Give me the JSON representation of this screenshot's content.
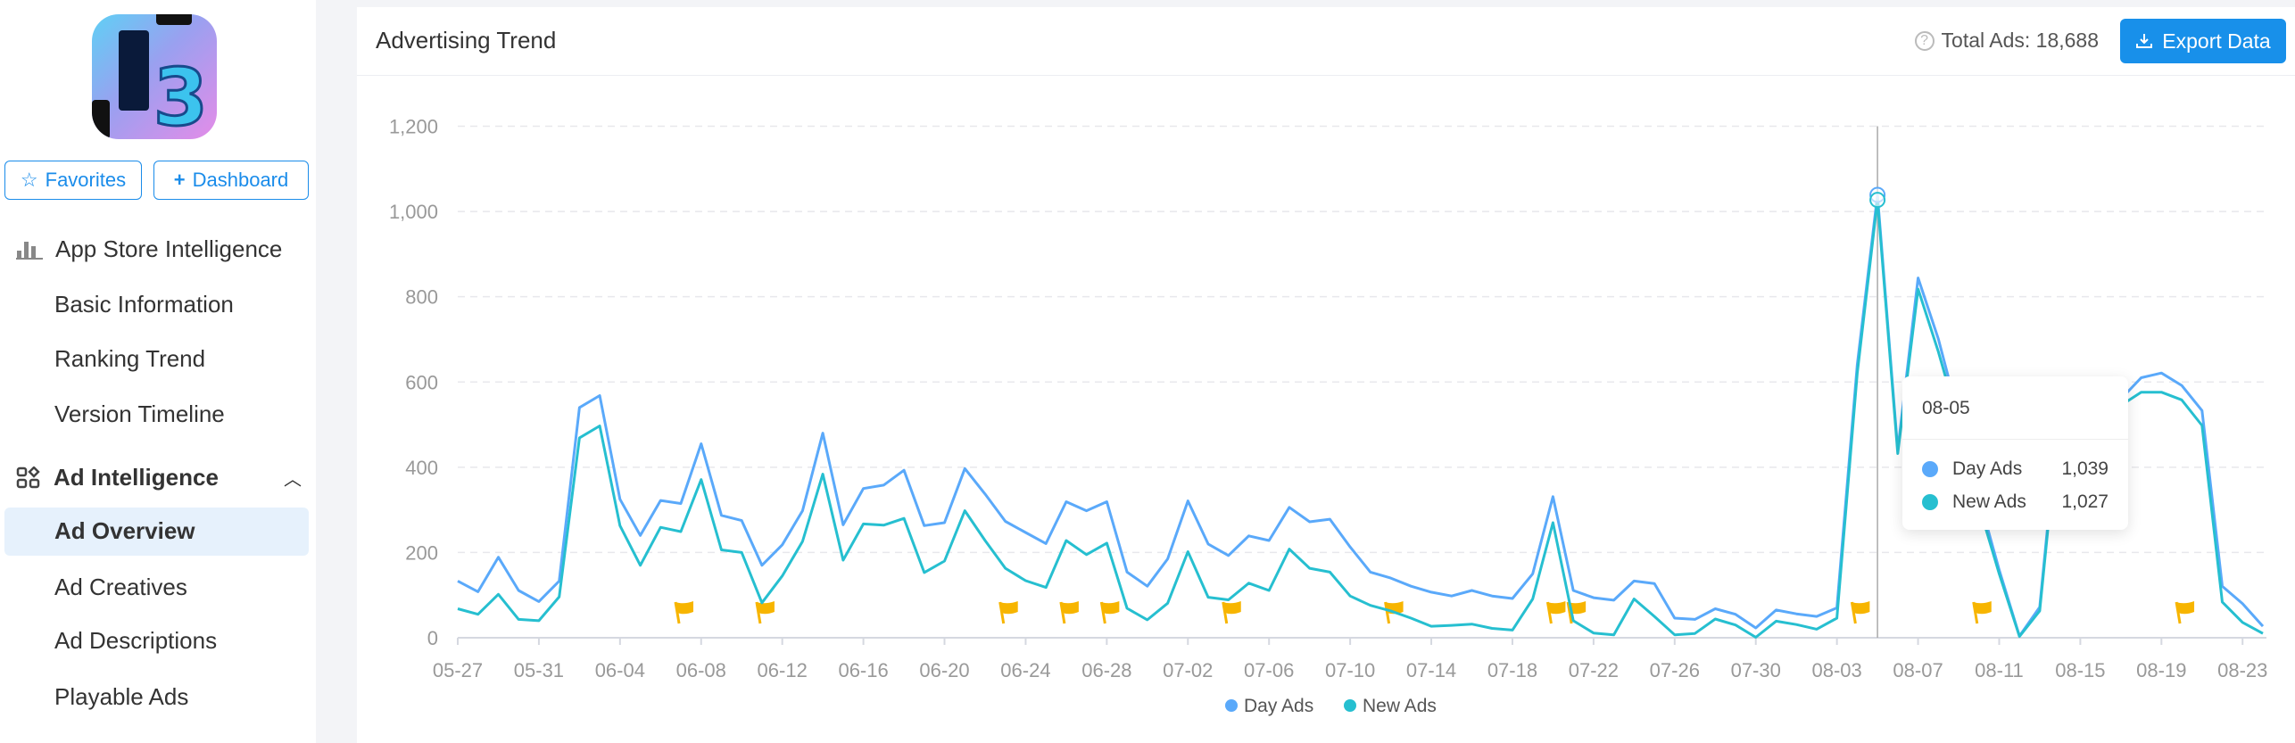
{
  "sidebar": {
    "app_icon_text": "3",
    "favorites_label": "Favorites",
    "dashboard_label": "Dashboard",
    "sections": [
      {
        "title": "App Store Intelligence",
        "icon": "bar-chart-icon",
        "items": [
          "Basic Information",
          "Ranking Trend",
          "Version Timeline"
        ]
      },
      {
        "title": "Ad Intelligence",
        "icon": "apps-grid-icon",
        "expanded": true,
        "items": [
          "Ad Overview",
          "Ad Creatives",
          "Ad Descriptions",
          "Playable Ads"
        ],
        "active": "Ad Overview"
      }
    ]
  },
  "card": {
    "title": "Advertising Trend",
    "total_label": "Total Ads: 18,688",
    "export_label": "Export Data"
  },
  "tooltip": {
    "date": "08-05",
    "rows": [
      {
        "name": "Day Ads",
        "value": "1,039"
      },
      {
        "name": "New Ads",
        "value": "1,027"
      }
    ]
  },
  "colors": {
    "day_ads": "#5aa9fa",
    "new_ads": "#26bfd0",
    "flag": "#f7b500",
    "accent": "#1890ea"
  },
  "chart_data": {
    "type": "line",
    "title": "",
    "xlabel": "",
    "ylabel": "",
    "ylim": [
      0,
      1200
    ],
    "y_ticks": [
      "0",
      "200",
      "400",
      "600",
      "800",
      "1,000",
      "1,200"
    ],
    "x_tick_labels": [
      "05-27",
      "05-31",
      "06-04",
      "06-08",
      "06-12",
      "06-16",
      "06-20",
      "06-24",
      "06-28",
      "07-02",
      "07-06",
      "07-10",
      "07-14",
      "07-18",
      "07-22",
      "07-26",
      "07-30",
      "08-03",
      "08-07",
      "08-11",
      "08-15",
      "08-19",
      "08-23"
    ],
    "grid": true,
    "legend": "bottom-center",
    "x": [
      "05-27",
      "05-28",
      "05-29",
      "05-30",
      "05-31",
      "06-01",
      "06-02",
      "06-03",
      "06-04",
      "06-05",
      "06-06",
      "06-07",
      "06-08",
      "06-09",
      "06-10",
      "06-11",
      "06-12",
      "06-13",
      "06-14",
      "06-15",
      "06-16",
      "06-17",
      "06-18",
      "06-19",
      "06-20",
      "06-21",
      "06-22",
      "06-23",
      "06-24",
      "06-25",
      "06-26",
      "06-27",
      "06-28",
      "06-29",
      "06-30",
      "07-01",
      "07-02",
      "07-03",
      "07-04",
      "07-05",
      "07-06",
      "07-07",
      "07-08",
      "07-09",
      "07-10",
      "07-11",
      "07-12",
      "07-13",
      "07-14",
      "07-15",
      "07-16",
      "07-17",
      "07-18",
      "07-19",
      "07-20",
      "07-21",
      "07-22",
      "07-23",
      "07-24",
      "07-25",
      "07-26",
      "07-27",
      "07-28",
      "07-29",
      "07-30",
      "07-31",
      "08-01",
      "08-02",
      "08-03",
      "08-04",
      "08-05",
      "08-06",
      "08-07",
      "08-08",
      "08-09",
      "08-10",
      "08-11",
      "08-12",
      "08-13",
      "08-14",
      "08-15",
      "08-16",
      "08-17",
      "08-18",
      "08-19",
      "08-20",
      "08-21",
      "08-22",
      "08-23",
      "08-24"
    ],
    "series": [
      {
        "name": "Day Ads",
        "values": [
          133,
          108,
          189,
          111,
          85,
          133,
          540,
          568,
          325,
          240,
          322,
          315,
          455,
          287,
          275,
          170,
          218,
          298,
          480,
          265,
          350,
          358,
          393,
          263,
          270,
          397,
          337,
          273,
          247,
          221,
          319,
          298,
          319,
          154,
          121,
          185,
          321,
          220,
          193,
          239,
          228,
          306,
          272,
          278,
          213,
          154,
          140,
          121,
          107,
          98,
          111,
          98,
          92,
          150,
          331,
          111,
          94,
          88,
          133,
          127,
          46,
          43,
          68,
          55,
          23,
          65,
          56,
          50,
          70,
          640,
          1039,
          440,
          844,
          701,
          520,
          330,
          159,
          4,
          72,
          560,
          580,
          570,
          560,
          610,
          621,
          592,
          533,
          121,
          80,
          27
        ]
      },
      {
        "name": "New Ads",
        "values": [
          68,
          55,
          102,
          43,
          40,
          96,
          469,
          497,
          263,
          170,
          259,
          249,
          371,
          206,
          200,
          82,
          145,
          226,
          384,
          182,
          267,
          264,
          280,
          153,
          180,
          298,
          228,
          163,
          134,
          118,
          228,
          195,
          222,
          69,
          42,
          81,
          202,
          95,
          89,
          128,
          111,
          208,
          163,
          154,
          98,
          76,
          63,
          46,
          27,
          29,
          32,
          22,
          18,
          91,
          270,
          40,
          11,
          7,
          91,
          50,
          7,
          10,
          44,
          30,
          1,
          39,
          31,
          20,
          46,
          620,
          1027,
          432,
          818,
          671,
          505,
          310,
          150,
          3,
          63,
          540,
          560,
          550,
          545,
          576,
          576,
          558,
          498,
          84,
          36,
          10
        ]
      }
    ],
    "event_flags": [
      "06-07",
      "06-11",
      "06-23",
      "06-26",
      "06-28",
      "07-04",
      "07-12",
      "07-20",
      "07-21",
      "08-04",
      "08-10",
      "08-20"
    ],
    "highlighted": "08-05"
  }
}
